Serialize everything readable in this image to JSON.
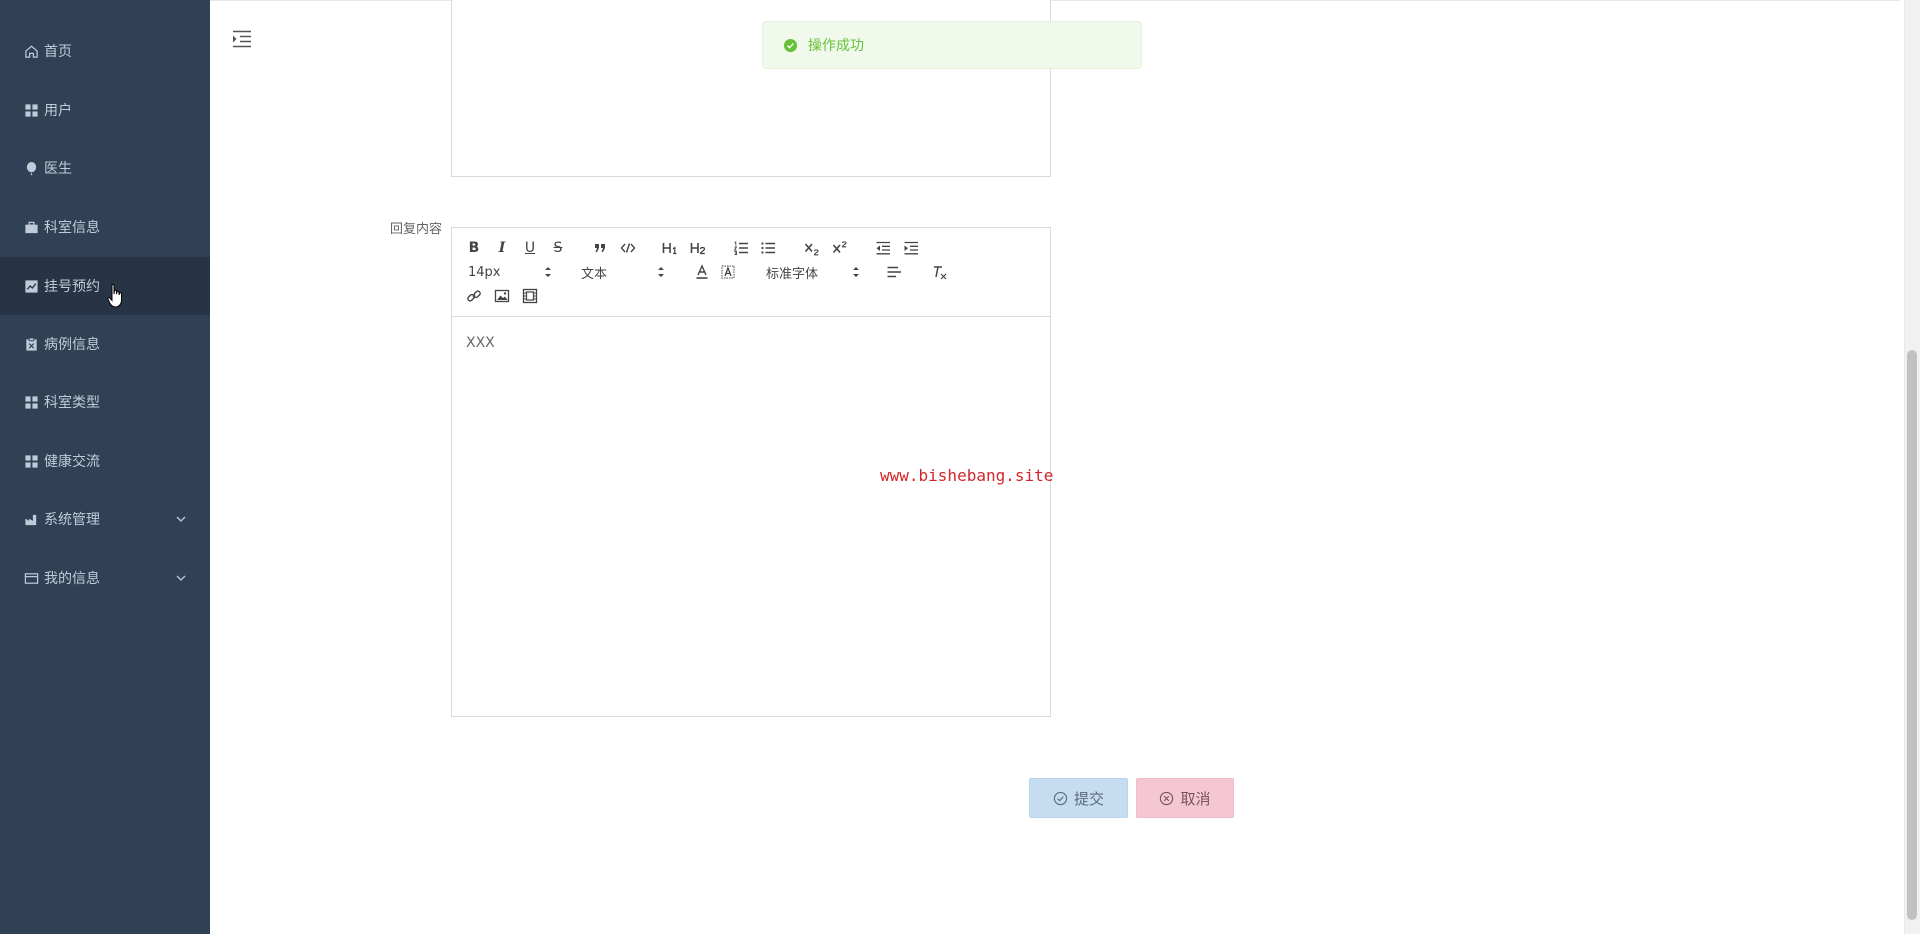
{
  "sidebar": {
    "items": [
      {
        "label": "首页",
        "icon": "home-icon"
      },
      {
        "label": "用户",
        "icon": "grid-icon"
      },
      {
        "label": "医生",
        "icon": "balloon-icon"
      },
      {
        "label": "科室信息",
        "icon": "briefcase-icon"
      },
      {
        "label": "挂号预约",
        "icon": "chart-icon",
        "active": true
      },
      {
        "label": "病例信息",
        "icon": "clipboard-icon"
      },
      {
        "label": "科室类型",
        "icon": "grid-icon"
      },
      {
        "label": "健康交流",
        "icon": "grid-icon"
      },
      {
        "label": "系统管理",
        "icon": "factory-icon",
        "expandable": true
      },
      {
        "label": "我的信息",
        "icon": "card-icon",
        "expandable": true
      }
    ]
  },
  "form": {
    "reply_label": "回复内容",
    "editor": {
      "font_size": "14px",
      "header_type": "文本",
      "font_family": "标准字体",
      "content": "XXX"
    }
  },
  "buttons": {
    "submit": "提交",
    "cancel": "取消"
  },
  "toast": {
    "message": "操作成功"
  },
  "watermark": "www.bishebang.site",
  "colors": {
    "sidebar_bg": "#304156",
    "sidebar_text": "#bfcbd9",
    "success": "#67c23a",
    "watermark": "#d0262c"
  }
}
